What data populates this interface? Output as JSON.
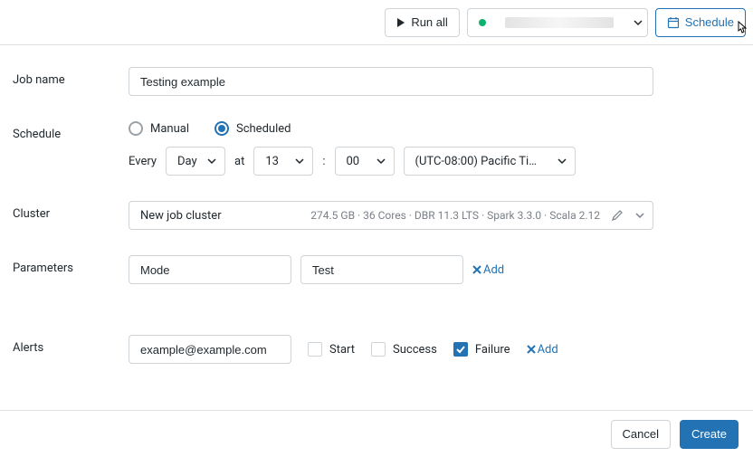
{
  "topbar": {
    "run_all_label": "Run all",
    "schedule_label": "Schedule"
  },
  "form": {
    "job_name_label": "Job name",
    "job_name_value": "Testing example",
    "schedule_label": "Schedule",
    "schedule_mode": {
      "manual_label": "Manual",
      "scheduled_label": "Scheduled",
      "selected": "scheduled"
    },
    "every_label": "Every",
    "at_label": "at",
    "colon_label": ":",
    "interval_unit": "Day",
    "hour": "13",
    "minute": "00",
    "timezone": "(UTC-08:00) Pacific Ti…",
    "cluster_label": "Cluster",
    "cluster": {
      "name": "New job cluster",
      "specs": "274.5 GB · 36 Cores · DBR 11.3 LTS · Spark 3.3.0 · Scala 2.12"
    },
    "parameters_label": "Parameters",
    "parameters": [
      {
        "key": "Mode",
        "value": "Test"
      }
    ],
    "add_label": "Add",
    "alerts_label": "Alerts",
    "alerts": {
      "email": "example@example.com",
      "start_label": "Start",
      "start_checked": false,
      "success_label": "Success",
      "success_checked": false,
      "failure_label": "Failure",
      "failure_checked": true
    }
  },
  "footer": {
    "cancel_label": "Cancel",
    "create_label": "Create"
  }
}
